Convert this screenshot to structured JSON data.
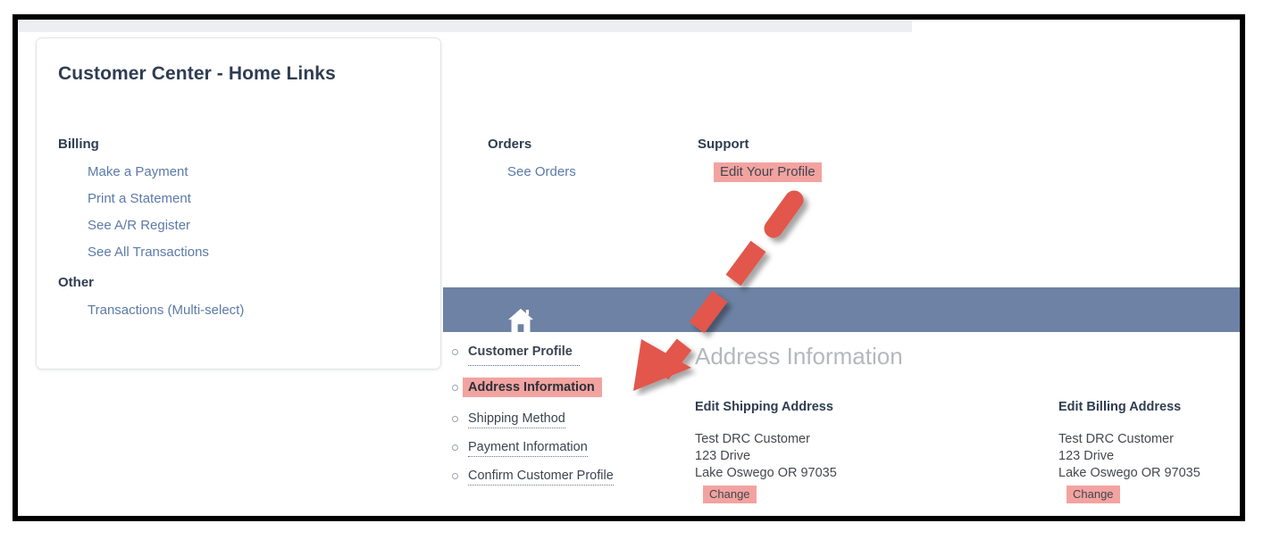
{
  "card": {
    "title": "Customer Center - Home Links",
    "columns": [
      {
        "name": "billing",
        "groups": [
          {
            "heading": "Billing",
            "links": [
              {
                "label": "Make a Payment",
                "highlighted": false
              },
              {
                "label": "Print a Statement",
                "highlighted": false
              },
              {
                "label": "See A/R Register",
                "highlighted": false
              },
              {
                "label": "See All Transactions",
                "highlighted": false
              }
            ]
          },
          {
            "heading": "Other",
            "links": [
              {
                "label": "Transactions (Multi-select)",
                "highlighted": false
              }
            ]
          }
        ]
      },
      {
        "name": "orders",
        "groups": [
          {
            "heading": "Orders",
            "links": [
              {
                "label": "See Orders",
                "highlighted": false
              }
            ]
          }
        ]
      },
      {
        "name": "support",
        "groups": [
          {
            "heading": "Support",
            "links": [
              {
                "label": "Edit Your Profile",
                "highlighted": true
              }
            ]
          }
        ]
      }
    ]
  },
  "app": {
    "home_icon": "home-icon",
    "nav": [
      {
        "label": "Customer Profile",
        "state": "header"
      },
      {
        "label": "Address Information",
        "state": "active"
      },
      {
        "label": "Shipping Method",
        "state": "normal"
      },
      {
        "label": "Payment Information",
        "state": "normal"
      },
      {
        "label": "Confirm Customer Profile",
        "state": "normal"
      }
    ],
    "page_title": "Address Information",
    "addresses": [
      {
        "heading": "Edit Shipping Address",
        "lines": [
          "Test DRC Customer",
          "123 Drive",
          "Lake Oswego OR 97035"
        ],
        "button": "Change"
      },
      {
        "heading": "Edit Billing Address",
        "lines": [
          "Test DRC Customer",
          "123 Drive",
          "Lake Oswego OR 97035"
        ],
        "button": "Change"
      }
    ]
  },
  "annotation": {
    "arrow": "red-dashed-arrow-icon"
  },
  "colors": {
    "highlight": "#f2a3a0",
    "app_bar": "#6d82a4",
    "link": "#5c7aa8",
    "heading": "#2f3d52",
    "arrow": "#e2574c"
  }
}
